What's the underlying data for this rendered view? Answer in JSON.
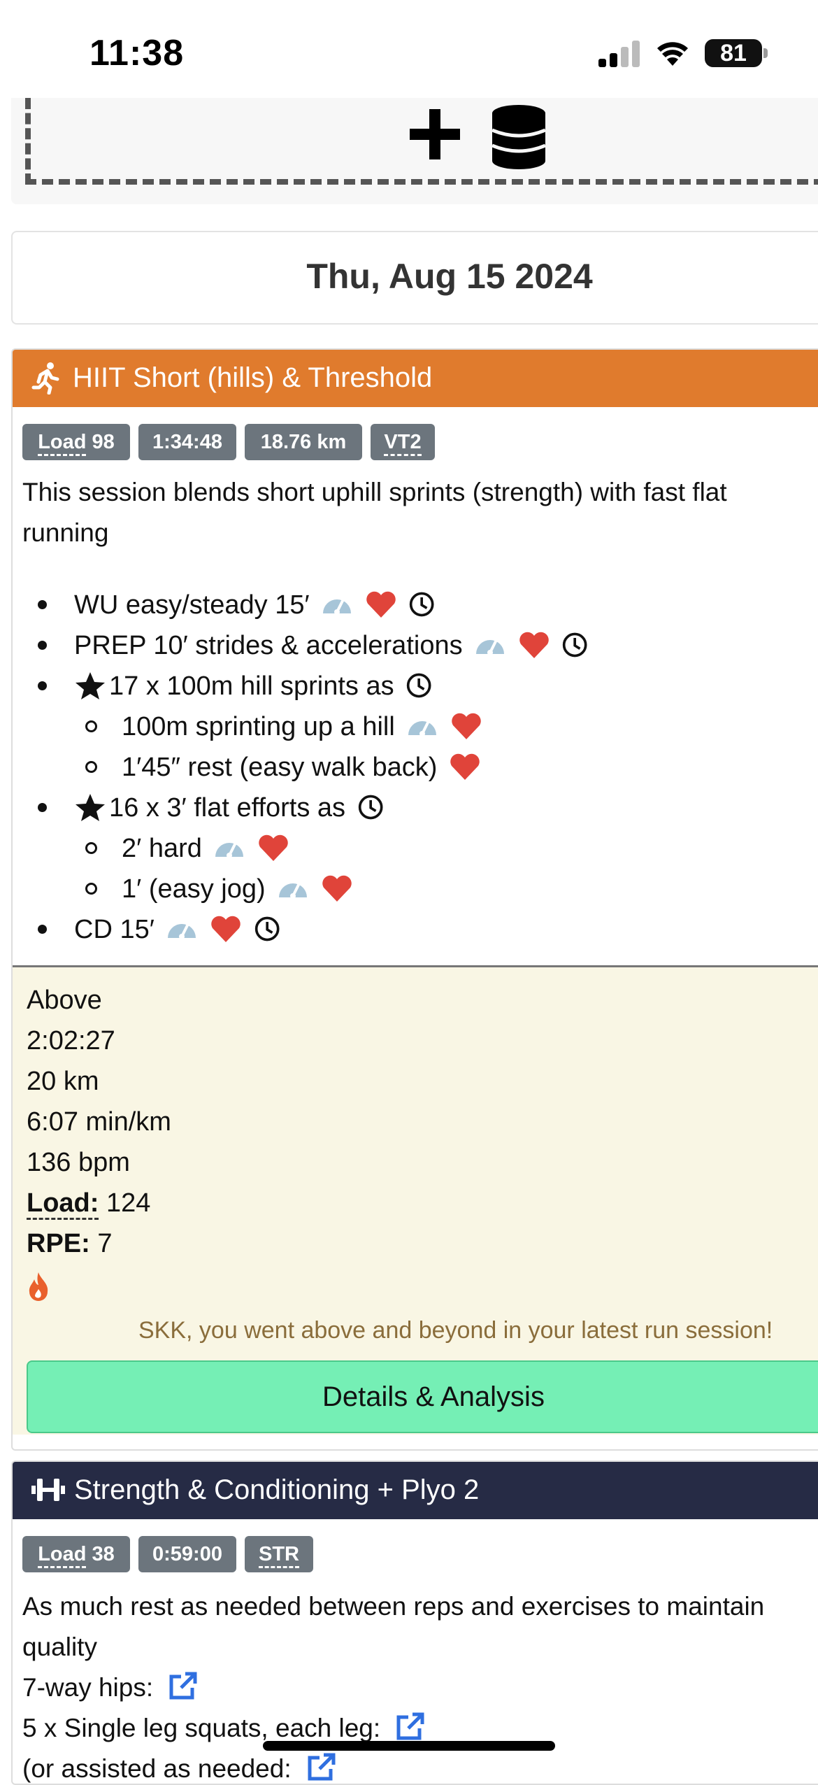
{
  "status_bar": {
    "time": "11:38",
    "battery": "81"
  },
  "date": "Thu, Aug 15 2024",
  "session1": {
    "title": "HIIT Short (hills) & Threshold",
    "header_color": "#e07b2d",
    "badges": {
      "load_label": "Load",
      "load_value": "98",
      "duration": "1:34:48",
      "distance": "18.76 km",
      "zone": "VT2"
    },
    "description_line1": "This session blends short uphill sprints (strength) with fast flat",
    "description_line2": "running",
    "steps": [
      {
        "text": "WU easy/steady 15′"
      },
      {
        "text": "PREP 10′ strides & accelerations"
      },
      {
        "text": "17 x 100m hill sprints as"
      },
      {
        "text": "100m sprinting up a hill"
      },
      {
        "text": "1′45″ rest (easy walk back)"
      },
      {
        "text": "16 x 3′ flat efforts as"
      },
      {
        "text": "2′ hard"
      },
      {
        "text": "1′ (easy jog)"
      },
      {
        "text": "CD 15′"
      }
    ],
    "result": {
      "verdict": "Above",
      "duration": "2:02:27",
      "distance": "20 km",
      "pace": "6:07 min/km",
      "heart_rate": "136 bpm",
      "load_label": "Load:",
      "load_value": "124",
      "rpe_label": "RPE:",
      "rpe_value": "7",
      "praise": "SKK, you went above and beyond in your latest run session!",
      "button": "Details & Analysis"
    }
  },
  "session2": {
    "title": "Strength & Conditioning + Plyo 2",
    "header_color": "#262b45",
    "badges": {
      "load_label": "Load",
      "load_value": "38",
      "duration": "0:59:00",
      "type": "STR"
    },
    "description_line1": "As much rest as needed between reps and exercises to maintain",
    "description_line2": "quality",
    "lines": [
      "7-way hips:",
      "5 x Single leg squats, each leg:",
      "(or assisted as needed:"
    ]
  },
  "colors": {
    "pace_icon": "#a7c5d8",
    "heart": "#e0443a",
    "button": "#75efb5",
    "link": "#2f6fe0"
  }
}
